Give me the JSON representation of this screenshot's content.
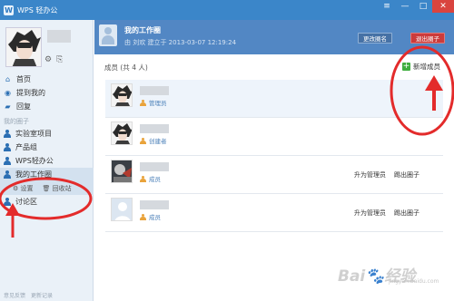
{
  "window": {
    "title": "WPS 轻办公",
    "logo_glyph": "W",
    "controls": {
      "menu": "≡",
      "minimize": "—",
      "maximize": "□",
      "close": "✕"
    }
  },
  "sidebar": {
    "profile": {
      "settings_icon": "gear-icon",
      "switch_icon": "switch-icon"
    },
    "nav": [
      {
        "label": "首页",
        "icon": "home-icon"
      },
      {
        "label": "提到我的",
        "icon": "mention-icon"
      },
      {
        "label": "回复",
        "icon": "reply-icon"
      }
    ],
    "section_label": "我的圈子",
    "circles": [
      {
        "label": "实验室项目"
      },
      {
        "label": "产品组"
      },
      {
        "label": "WPS轻办公"
      },
      {
        "label": "我的工作圈"
      },
      {
        "label": "讨论区"
      }
    ],
    "active_circle_actions": {
      "settings": "设置",
      "recycle": "回收站"
    },
    "footer": {
      "left": "意见反馈",
      "right": "更新记录"
    }
  },
  "header": {
    "title": "我的工作圈",
    "meta": "由 刘欢 建立于 2013-03-07 12:19:24",
    "rename_button": "更改圈名",
    "quit_button": "退出圈子"
  },
  "members": {
    "count_label": "成员 (共 4 人)",
    "add_button": "新增成员",
    "list": [
      {
        "role": "管理员",
        "avatar": "anime-avatar",
        "promote": "",
        "kick": ""
      },
      {
        "role": "创建者",
        "avatar": "anime-avatar",
        "promote": "",
        "kick": ""
      },
      {
        "role": "成员",
        "avatar": "game-avatar",
        "promote": "升为管理员",
        "kick": "踢出圈子"
      },
      {
        "role": "成员",
        "avatar": "default-avatar",
        "promote": "升为管理员",
        "kick": "踢出圈子"
      }
    ]
  },
  "watermark": {
    "text": "Bai🐾经验",
    "sub": "jingyan.baidu.com"
  },
  "colors": {
    "titlebar": "#3b86c9",
    "header": "#5287c4",
    "sidebar": "#eaf1f8",
    "quit_red": "#cc3b3b",
    "annotation_red": "#e32b2b",
    "add_green": "#3fae3f"
  }
}
